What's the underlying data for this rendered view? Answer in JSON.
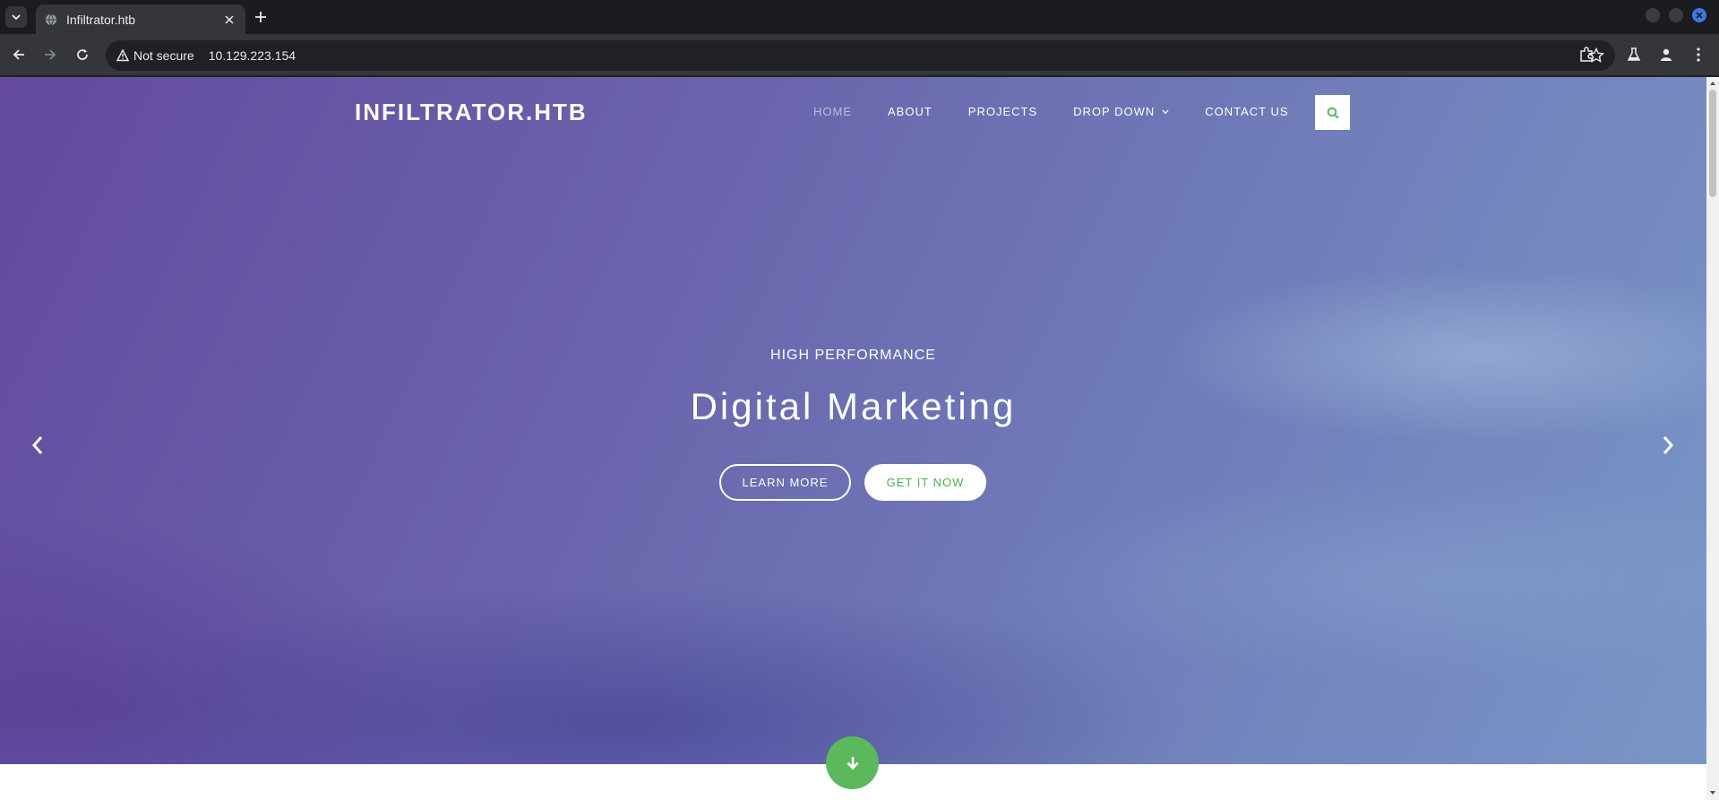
{
  "browser": {
    "tab_title": "Infiltrator.htb",
    "security_label": "Not secure",
    "url": "10.129.223.154"
  },
  "site": {
    "brand": "INFILTRATOR.HTB",
    "nav": [
      {
        "label": "HOME"
      },
      {
        "label": "ABOUT"
      },
      {
        "label": "PROJECTS"
      },
      {
        "label": "DROP DOWN"
      },
      {
        "label": "CONTACT US"
      }
    ]
  },
  "hero": {
    "eyebrow": "HIGH PERFORMANCE",
    "headline": "Digital Marketing",
    "learn_more": "LEARN MORE",
    "get_it_now": "GET IT NOW"
  },
  "icons": {
    "tab_favicon": "globe-icon",
    "search": "search-icon",
    "prev": "chevron-left-icon",
    "next": "chevron-right-icon",
    "scroll_down": "arrow-down-icon"
  },
  "colors": {
    "accent_green": "#5cb85c",
    "hero_purple": "#634a9e",
    "hero_blue": "#7a96c6",
    "nav_active": "#b9bedd"
  }
}
